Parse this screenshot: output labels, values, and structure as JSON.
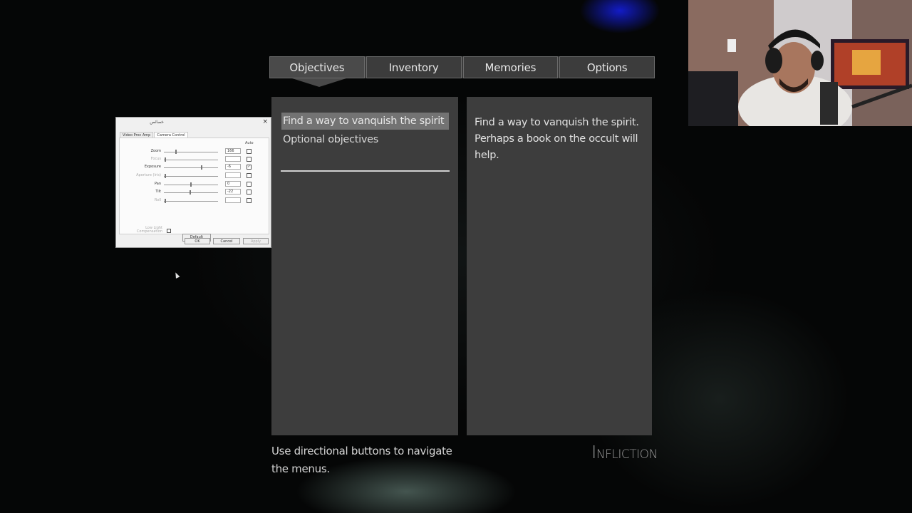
{
  "tabs": [
    {
      "label": "Objectives",
      "active": true
    },
    {
      "label": "Inventory",
      "active": false
    },
    {
      "label": "Memories",
      "active": false
    },
    {
      "label": "Options",
      "active": false
    }
  ],
  "objectives": {
    "items": [
      {
        "label": "Find a way to vanquish the spirit",
        "selected": true
      },
      {
        "label": "Optional objectives",
        "selected": false
      }
    ]
  },
  "description": {
    "text": "Find a way to vanquish the spirit. Perhaps a book on the occult will help."
  },
  "hint": {
    "text": "Use directional buttons to navigate the menus."
  },
  "logo": {
    "first_letter": "I",
    "rest": "NFLICTION"
  },
  "dialog": {
    "title": "خصائص",
    "close_glyph": "×",
    "tabs": [
      "Video Proc Amp",
      "Camera Control"
    ],
    "active_tab": "Camera Control",
    "auto_label": "Auto",
    "rows": [
      {
        "label": "Zoom",
        "value": "166",
        "checked": false,
        "enabled": true,
        "level": 0.22
      },
      {
        "label": "Focus",
        "value": "",
        "checked": false,
        "enabled": false,
        "level": 0.02
      },
      {
        "label": "Exposure",
        "value": "-6",
        "checked": true,
        "enabled": true,
        "level": 0.7
      },
      {
        "label": "Aperture (Iris)",
        "value": "",
        "checked": false,
        "enabled": false,
        "level": 0.02
      },
      {
        "label": "Pan",
        "value": "0",
        "checked": false,
        "enabled": true,
        "level": 0.5
      },
      {
        "label": "Tilt",
        "value": "-22",
        "checked": false,
        "enabled": true,
        "level": 0.48
      },
      {
        "label": "Roll",
        "value": "",
        "checked": false,
        "enabled": false,
        "level": 0.02
      }
    ],
    "low_light_label": "Low Light Compensation",
    "default_label": "Default",
    "ok_label": "OK",
    "cancel_label": "Cancel",
    "apply_label": "Apply"
  },
  "colors": {
    "panel": "#3d3d3d",
    "selection": "#737373",
    "text": "#e2e2e2"
  }
}
